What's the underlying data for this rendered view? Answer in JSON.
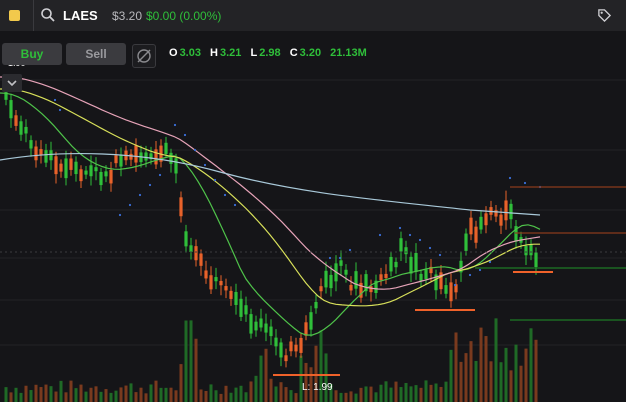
{
  "symbol": {
    "ticker": "LAES",
    "price": "$3.20",
    "change": "$0.00 (0.00%)"
  },
  "toolbar": {
    "buy_label": "Buy",
    "sell_label": "Sell"
  },
  "ohlcv": {
    "o_key": "O",
    "o": "3.03",
    "h_key": "H",
    "h": "3.21",
    "l_key": "L",
    "l": "2.98",
    "c_key": "C",
    "c": "3.20",
    "v": "21.13M"
  },
  "chart": {
    "low_label": "L: 1.99",
    "left_fragment": "1.90"
  },
  "colors": {
    "up": "#2fbf3a",
    "down": "#e8622a",
    "ma_pink": "#e6a3b8",
    "ma_yellow": "#d8e05a",
    "ma_green": "#4fc34a",
    "ma_blue": "#a9c9d9",
    "psar": "#3b6fd8"
  },
  "icons": {
    "search": "search-icon",
    "tag": "price-tag-icon",
    "draw": "crossed-circle-icon",
    "collapse": "chevron-down-icon"
  }
}
